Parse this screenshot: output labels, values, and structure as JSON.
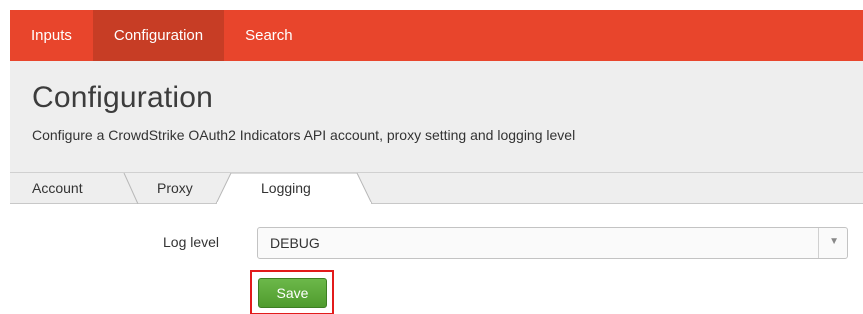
{
  "nav": {
    "items": [
      {
        "label": "Inputs"
      },
      {
        "label": "Configuration",
        "active": true
      },
      {
        "label": "Search"
      }
    ],
    "background": "#e8452c",
    "active_background": "#c73d25"
  },
  "header": {
    "title": "Configuration",
    "subtitle": "Configure a CrowdStrike OAuth2 Indicators API account, proxy setting and logging level"
  },
  "tabs": [
    {
      "label": "Account"
    },
    {
      "label": "Proxy"
    },
    {
      "label": "Logging",
      "active": true
    }
  ],
  "form": {
    "log_level_label": "Log level",
    "log_level_value": "DEBUG",
    "save_label": "Save"
  },
  "colors": {
    "save_button": "#5aa83a",
    "highlight": "#e21b1b"
  }
}
